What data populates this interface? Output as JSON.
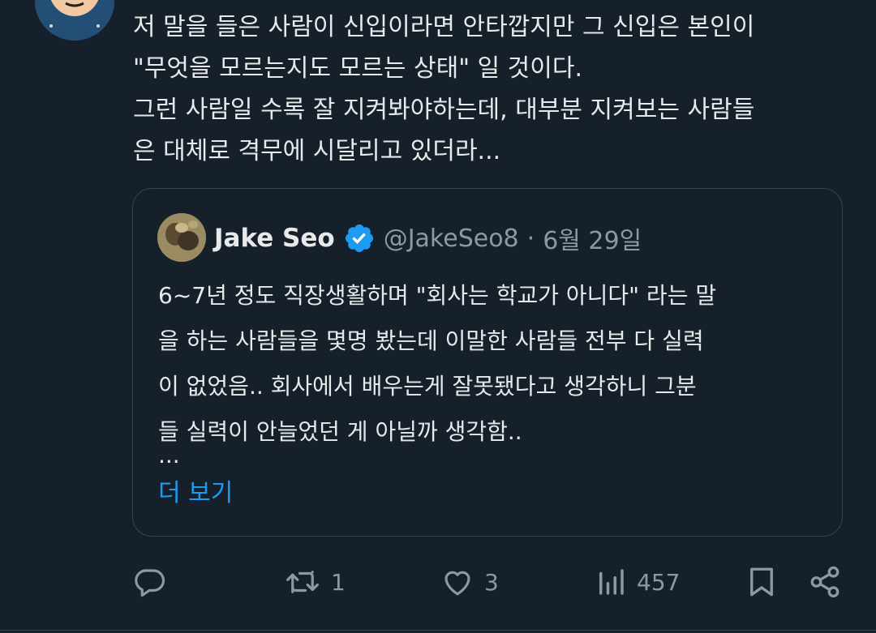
{
  "tweet": {
    "text_lines": [
      "저 말을 들은 사람이 신입이라면 안타깝지만 그 신입은 본인이",
      "\"무엇을 모르는지도 모르는 상태\" 일 것이다.",
      "그런 사람일 수록 잘 지켜봐야하는데, 대부분 지켜보는 사람들",
      "은  대체로 격무에 시달리고 있더라..."
    ]
  },
  "quote": {
    "name": "Jake Seo",
    "handle": "@JakeSeo8",
    "separator": "·",
    "date": "6월 29일",
    "body_lines": [
      "6~7년 정도 직장생활하며 \"회사는 학교가 아니다\" 라는 말",
      "을 하는 사람들을 몇명 봤는데 이말한 사람들 전부 다 실력",
      "이 없었음.. 회사에서 배우는게 잘못됐다고 생각하니 그분",
      "들 실력이 안늘었던 게 아닐까 생각함.."
    ],
    "ellipsis": "...",
    "show_more": "더 보기"
  },
  "actions": {
    "reply": {
      "icon": "reply-icon",
      "count": ""
    },
    "retweet": {
      "icon": "retweet-icon",
      "count": "1"
    },
    "like": {
      "icon": "like-icon",
      "count": "3"
    },
    "views": {
      "icon": "views-icon",
      "count": "457"
    },
    "bookmark": {
      "icon": "bookmark-icon"
    },
    "share": {
      "icon": "share-icon"
    }
  },
  "colors": {
    "background": "#15202b",
    "text": "#e7e9ea",
    "muted": "#8b98a5",
    "accent": "#1d9bf0",
    "border": "#38444d"
  }
}
